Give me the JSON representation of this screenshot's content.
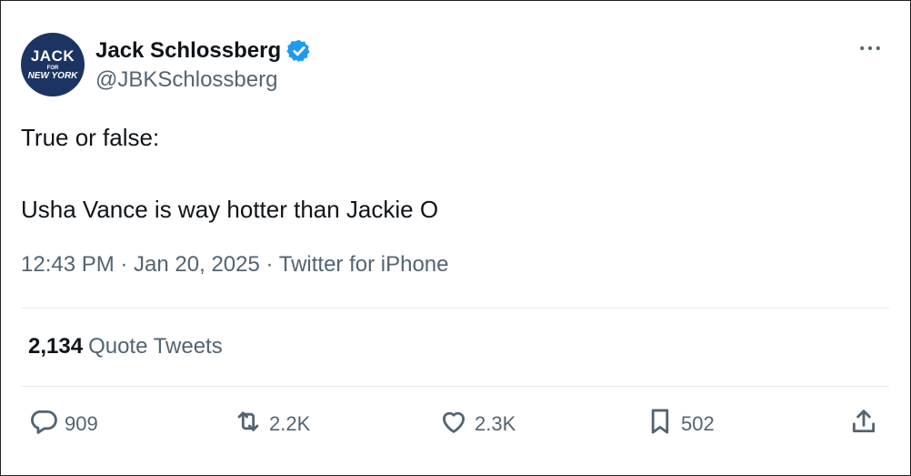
{
  "author": {
    "avatar": {
      "line1": "JACK",
      "line2": "FOR",
      "line3": "NEW YORK"
    },
    "display_name": "Jack Schlossberg",
    "handle": "@JBKSchlossberg",
    "verified_icon": "verified-badge-icon",
    "verified_color": "#1d9bf0"
  },
  "tweet": {
    "line1": "True or false:",
    "line2": "Usha Vance is way hotter than Jackie O",
    "meta": "12:43 PM · Jan 20, 2025 · Twitter for iPhone"
  },
  "stats": {
    "quote_count": "2,134",
    "quote_label": "Quote Tweets"
  },
  "actions": {
    "reply": {
      "icon": "reply-icon",
      "count": "909"
    },
    "retweet": {
      "icon": "retweet-icon",
      "count": "2.2K"
    },
    "like": {
      "icon": "heart-icon",
      "count": "2.3K"
    },
    "bookmark": {
      "icon": "bookmark-icon",
      "count": "502"
    },
    "share": {
      "icon": "share-icon"
    }
  },
  "colors": {
    "text": "#0f1419",
    "secondary": "#536471",
    "divider": "#e6ecf0",
    "avatar_bg": "#1c3461"
  }
}
